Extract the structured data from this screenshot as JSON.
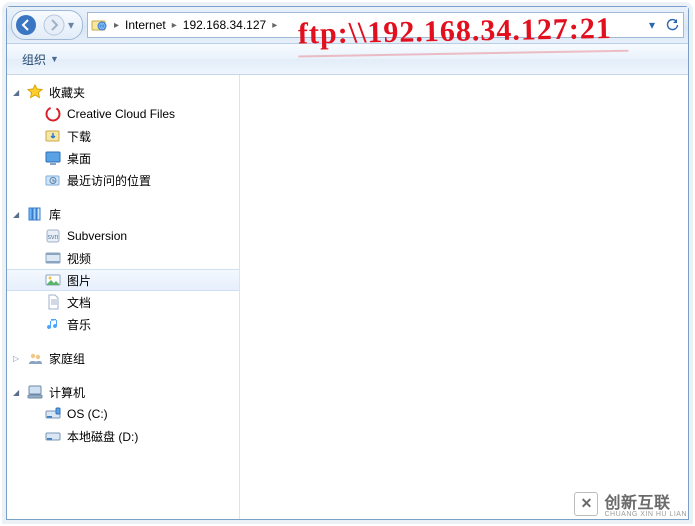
{
  "addressbar": {
    "protocol_icon": "globe-folder",
    "crumbs": [
      "Internet",
      "192.168.34.127"
    ],
    "refresh_label": "刷新"
  },
  "toolbar": {
    "organize_label": "组织"
  },
  "sidebar": {
    "favorites": {
      "label": "收藏夹",
      "items": [
        {
          "icon": "cc-icon",
          "label": "Creative Cloud Files"
        },
        {
          "icon": "download-icon",
          "label": "下载"
        },
        {
          "icon": "desktop-icon",
          "label": "桌面"
        },
        {
          "icon": "recent-icon",
          "label": "最近访问的位置"
        }
      ]
    },
    "libraries": {
      "label": "库",
      "items": [
        {
          "icon": "svn-icon",
          "label": "Subversion",
          "selected": false
        },
        {
          "icon": "video-icon",
          "label": "视频",
          "selected": false
        },
        {
          "icon": "image-icon",
          "label": "图片",
          "selected": true
        },
        {
          "icon": "doc-icon",
          "label": "文档",
          "selected": false
        },
        {
          "icon": "music-icon",
          "label": "音乐",
          "selected": false
        }
      ]
    },
    "homegroup": {
      "label": "家庭组"
    },
    "computer": {
      "label": "计算机",
      "items": [
        {
          "icon": "drive-c-icon",
          "label": "OS (C:)"
        },
        {
          "icon": "drive-d-icon",
          "label": "本地磁盘 (D:)"
        }
      ]
    }
  },
  "annotation": "ftp:\\\\192.168.34.127:21",
  "watermark": {
    "brand": "创新互联",
    "sub": "CHUANG XIN HU LIAN",
    "glyph": "✕"
  }
}
